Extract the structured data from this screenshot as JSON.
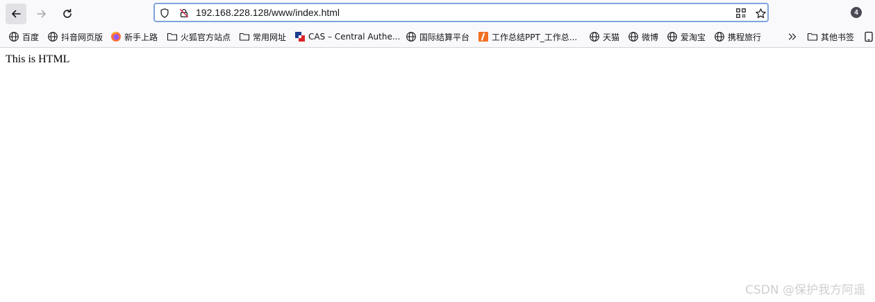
{
  "browser": {
    "url": "192.168.228.128/www/index.html",
    "tab_count": "4",
    "accent_color": "#7fa3df"
  },
  "bookmarks": [
    {
      "label": "百度",
      "icon": "globe-icon"
    },
    {
      "label": "抖音网页版",
      "icon": "globe-icon"
    },
    {
      "label": "新手上路",
      "icon": "firefox-icon"
    },
    {
      "label": "火狐官方站点",
      "icon": "folder-icon"
    },
    {
      "label": "常用网址",
      "icon": "folder-icon"
    },
    {
      "label": "CAS – Central Authe...",
      "icon": "cas-icon"
    },
    {
      "label": "国际结算平台",
      "icon": "globe-icon"
    },
    {
      "label": "工作总结PPT_工作总...",
      "icon": "ppt-icon"
    },
    {
      "label": "天猫",
      "icon": "globe-icon"
    },
    {
      "label": "微博",
      "icon": "globe-icon"
    },
    {
      "label": "爱淘宝",
      "icon": "globe-icon"
    },
    {
      "label": "携程旅行",
      "icon": "globe-icon"
    }
  ],
  "other_bookmarks": {
    "label": "其他书签",
    "icon": "folder-icon"
  },
  "page": {
    "body_text": "This is HTML"
  },
  "watermark": "CSDN @保护我方阿遥"
}
